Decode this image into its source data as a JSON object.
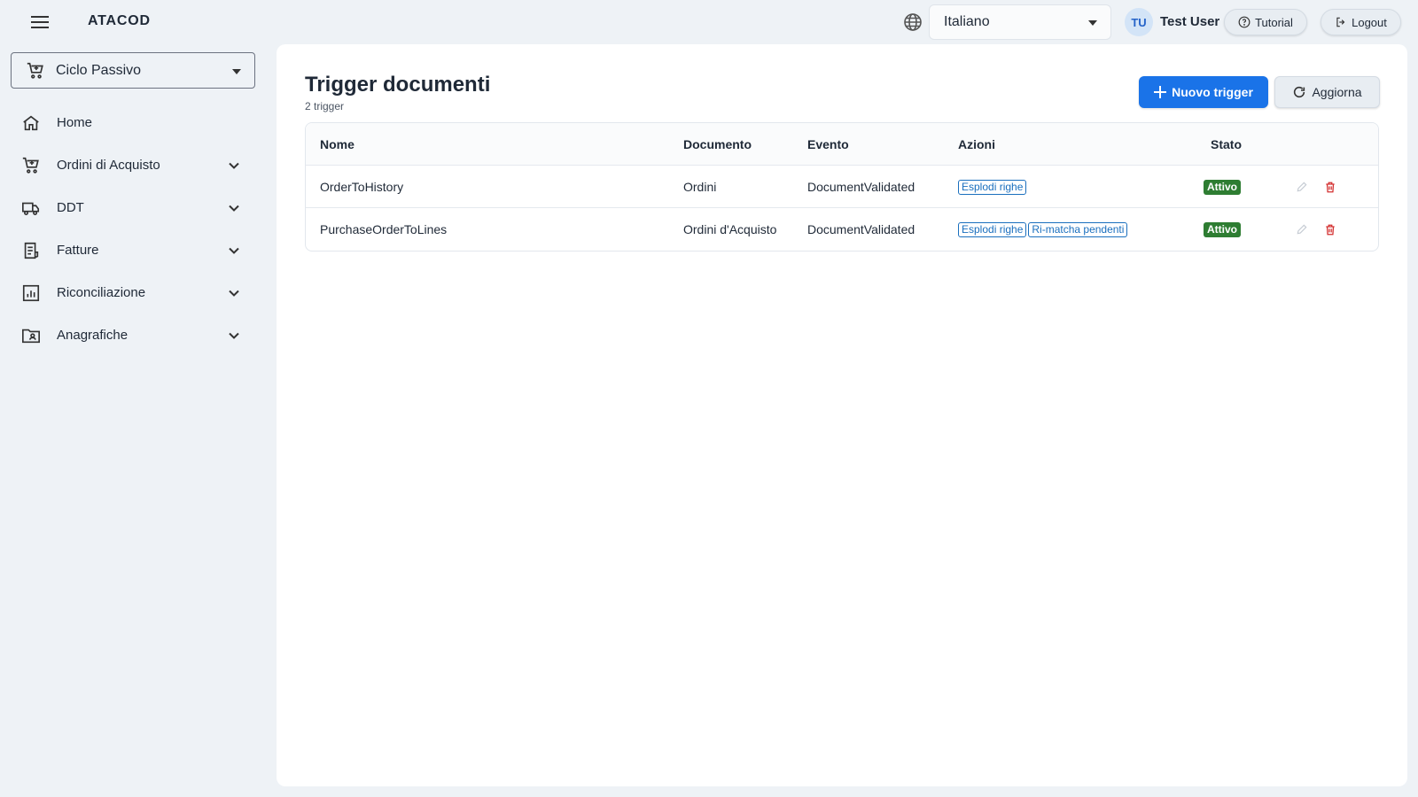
{
  "app": {
    "title": "ATACOD"
  },
  "topbar": {
    "language": "Italiano",
    "user_initials": "TU",
    "user_name": "Test User",
    "tutorial_label": "Tutorial",
    "logout_label": "Logout"
  },
  "sidebar": {
    "module": "Ciclo Passivo",
    "items": [
      {
        "label": "Home",
        "icon": "home-icon"
      },
      {
        "label": "Ordini di Acquisto",
        "icon": "cart-icon"
      },
      {
        "label": "DDT",
        "icon": "truck-icon"
      },
      {
        "label": "Fatture",
        "icon": "receipt-icon"
      },
      {
        "label": "Riconciliazione",
        "icon": "chart-icon"
      },
      {
        "label": "Anagrafiche",
        "icon": "contacts-folder-icon"
      }
    ]
  },
  "page": {
    "title": "Trigger documenti",
    "subtitle": "2 trigger",
    "new_button": "Nuovo trigger",
    "refresh_button": "Aggiorna"
  },
  "table": {
    "headers": {
      "nome": "Nome",
      "documento": "Documento",
      "evento": "Evento",
      "azioni": "Azioni",
      "stato": "Stato"
    },
    "rows": [
      {
        "nome": "OrderToHistory",
        "documento": "Ordini",
        "evento": "DocumentValidated",
        "azioni": [
          "Esplodi righe"
        ],
        "stato": "Attivo"
      },
      {
        "nome": "PurchaseOrderToLines",
        "documento": "Ordini d'Acquisto",
        "evento": "DocumentValidated",
        "azioni": [
          "Esplodi righe",
          "Ri-matcha pendenti"
        ],
        "stato": "Attivo"
      }
    ]
  },
  "colors": {
    "primary": "#1a73e8",
    "status_active": "#2e7d32",
    "chip": "#1a6fbe",
    "delete": "#d32f2f",
    "background": "#eef2f6"
  }
}
